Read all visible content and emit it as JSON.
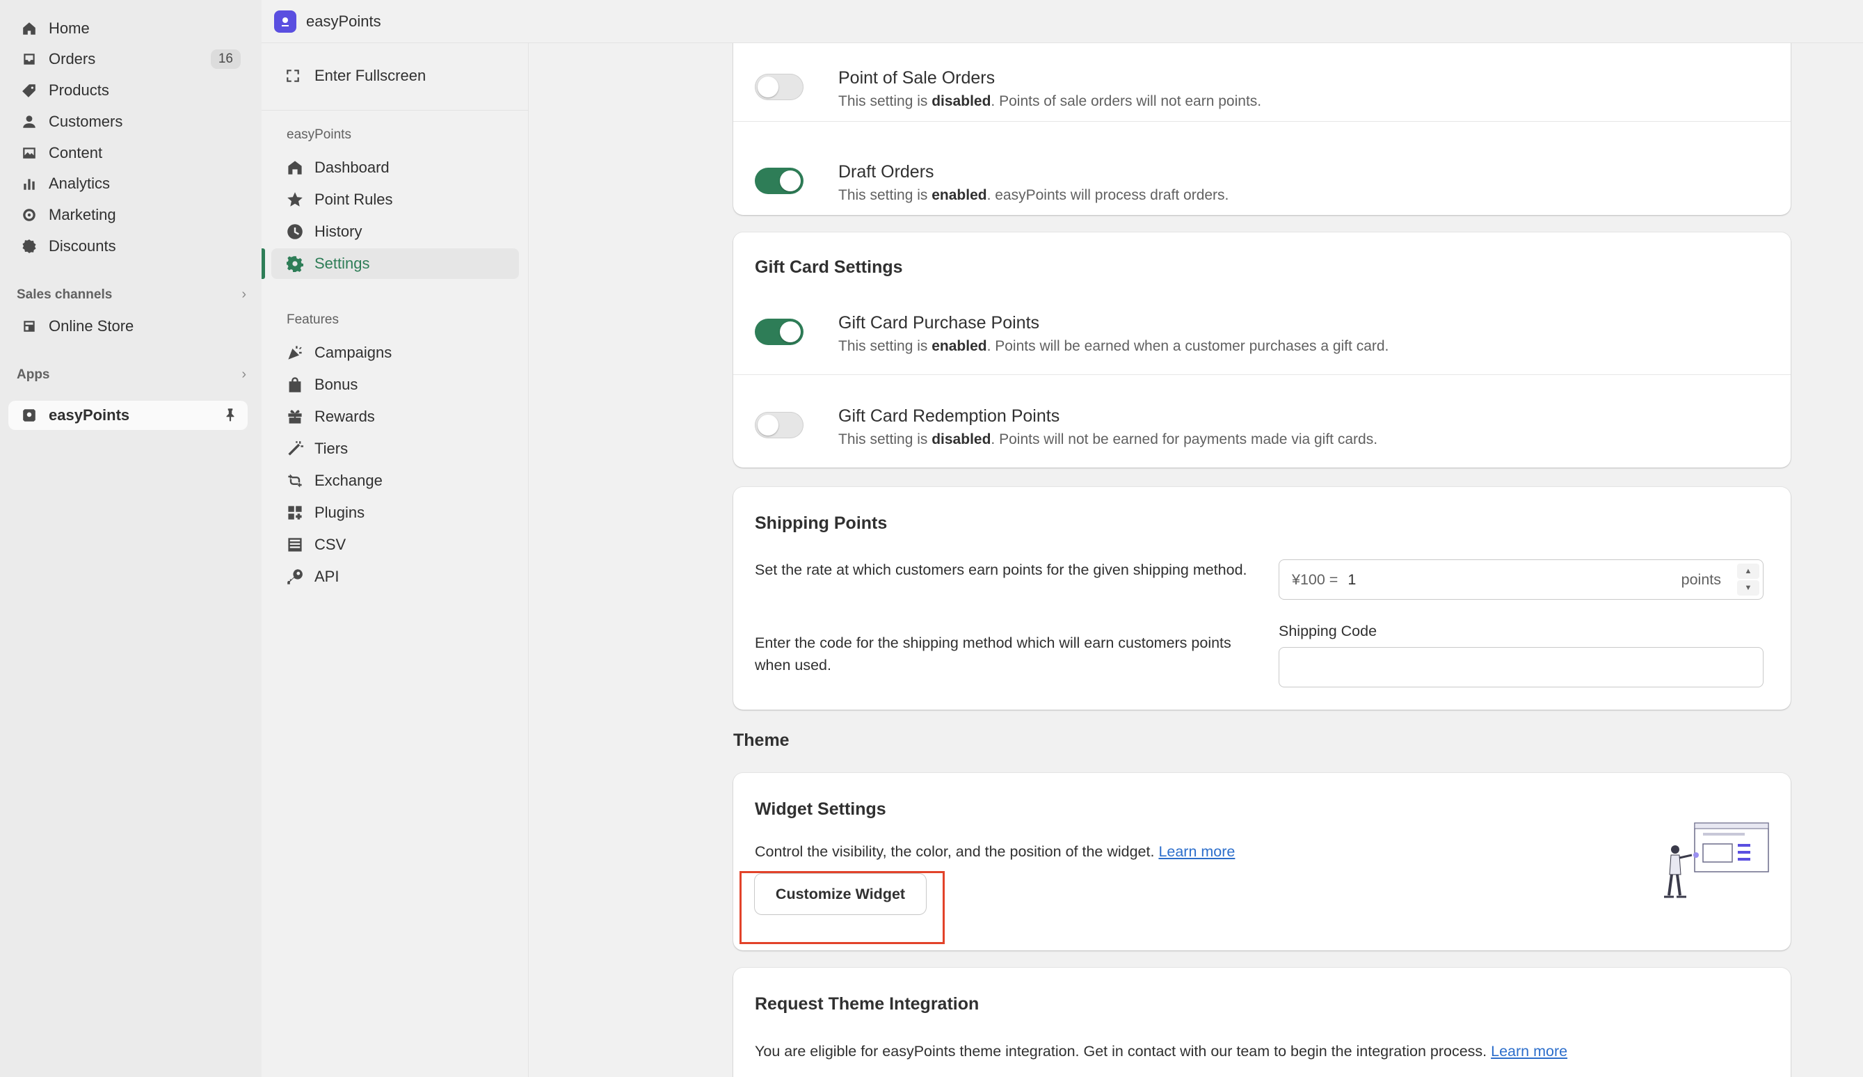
{
  "admin_nav": {
    "items": [
      {
        "label": "Home",
        "icon": "home-icon"
      },
      {
        "label": "Orders",
        "icon": "orders-icon",
        "badge": "16"
      },
      {
        "label": "Products",
        "icon": "tag-icon"
      },
      {
        "label": "Customers",
        "icon": "person-icon"
      },
      {
        "label": "Content",
        "icon": "image-icon"
      },
      {
        "label": "Analytics",
        "icon": "bar-chart-icon"
      },
      {
        "label": "Marketing",
        "icon": "target-icon"
      },
      {
        "label": "Discounts",
        "icon": "discount-icon"
      }
    ],
    "sales_channels_label": "Sales channels",
    "online_store_label": "Online Store",
    "apps_label": "Apps",
    "app_label": "easyPoints"
  },
  "top_bar": {
    "title": "easyPoints"
  },
  "app_nav": {
    "fullscreen_label": "Enter Fullscreen",
    "group_label": "easyPoints",
    "items": [
      {
        "label": "Dashboard"
      },
      {
        "label": "Point Rules"
      },
      {
        "label": "History"
      },
      {
        "label": "Settings"
      }
    ],
    "features_label": "Features",
    "features": [
      {
        "label": "Campaigns"
      },
      {
        "label": "Bonus"
      },
      {
        "label": "Rewards"
      },
      {
        "label": "Tiers"
      },
      {
        "label": "Exchange"
      },
      {
        "label": "Plugins"
      },
      {
        "label": "CSV"
      },
      {
        "label": "API"
      }
    ]
  },
  "orders_card": {
    "pos": {
      "title": "Point of Sale Orders",
      "desc_pre": "This setting is ",
      "desc_state": "disabled",
      "desc_post": ". Points of sale orders will not earn points.",
      "enabled": false
    },
    "draft": {
      "title": "Draft Orders",
      "desc_pre": "This setting is ",
      "desc_state": "enabled",
      "desc_post": ". easyPoints will process draft orders.",
      "enabled": true
    }
  },
  "gift_card": {
    "title": "Gift Card Settings",
    "purchase": {
      "title": "Gift Card Purchase Points",
      "desc_pre": "This setting is ",
      "desc_state": "enabled",
      "desc_post": ". Points will be earned when a customer purchases a gift card.",
      "enabled": true
    },
    "redemption": {
      "title": "Gift Card Redemption Points",
      "desc_pre": "This setting is ",
      "desc_state": "disabled",
      "desc_post": ". Points will not be earned for payments made via gift cards.",
      "enabled": false
    }
  },
  "shipping": {
    "title": "Shipping Points",
    "rate_text": "Set the rate at which customers earn points for the given shipping method.",
    "rate_prefix": "¥100 =",
    "rate_value": "1",
    "rate_suffix": "points",
    "code_text": "Enter the code for the shipping method which will earn customers points when used.",
    "code_label": "Shipping Code",
    "code_value": ""
  },
  "theme": {
    "heading": "Theme",
    "widget_title": "Widget Settings",
    "widget_text": "Control the visibility, the color, and the position of the widget.",
    "widget_link": "Learn more",
    "customize_button": "Customize Widget",
    "integration_title": "Request Theme Integration",
    "integration_text": "You are eligible for easyPoints theme integration. Get in contact with our team to begin the integration process.",
    "integration_link": "Learn more"
  },
  "colors": {
    "accent": "#2e7d57",
    "link": "#2c6ecb",
    "highlight": "#e2432a",
    "brand": "#5a4fe0"
  }
}
